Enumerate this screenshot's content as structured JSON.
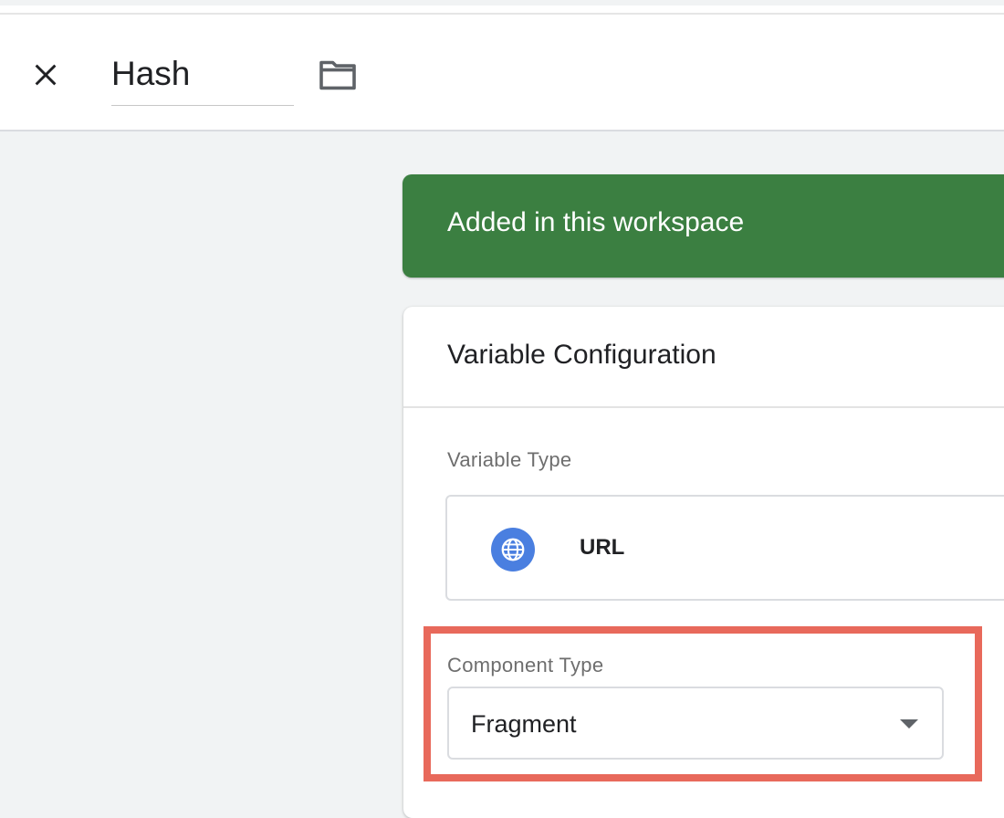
{
  "header": {
    "name_value": "Hash",
    "close_icon": "close-icon",
    "folder_icon": "folder-icon"
  },
  "banner": {
    "text": "Added in this workspace",
    "color": "#3b7f41"
  },
  "card": {
    "title": "Variable Configuration",
    "variable_type_label": "Variable Type",
    "variable_type_value": "URL",
    "variable_type_icon": "globe-icon",
    "component_type_label": "Component Type",
    "component_type_value": "Fragment"
  },
  "highlight_color": "#e8695b"
}
